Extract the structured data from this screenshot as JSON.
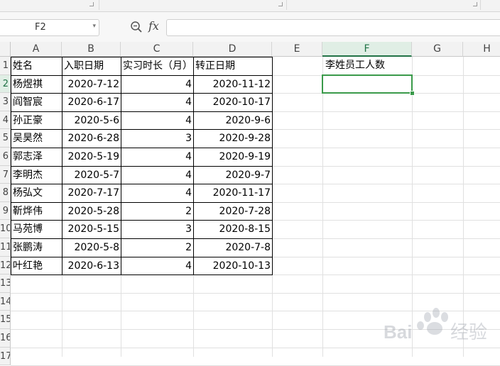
{
  "namebox": {
    "value": "F2"
  },
  "formula": {
    "fx_label": "fx",
    "value": ""
  },
  "columns": [
    "A",
    "B",
    "C",
    "D",
    "E",
    "F",
    "G",
    "H"
  ],
  "active_column": "F",
  "active_row": "2",
  "rows": [
    "1",
    "2",
    "3",
    "4",
    "5",
    "6",
    "7",
    "8",
    "9",
    "10",
    "11",
    "12",
    "13",
    "14",
    "15",
    "16",
    "17"
  ],
  "table": {
    "headers": [
      "姓名",
      "入职日期",
      "实习时长（月）",
      "转正日期"
    ],
    "records": [
      [
        "杨煜祺",
        "2020-7-12",
        "4",
        "2020-11-12"
      ],
      [
        "阎智宸",
        "2020-6-17",
        "4",
        "2020-10-17"
      ],
      [
        "孙正豪",
        "2020-5-6",
        "4",
        "2020-9-6"
      ],
      [
        "吴昊然",
        "2020-6-28",
        "3",
        "2020-9-28"
      ],
      [
        "郭志泽",
        "2020-5-19",
        "4",
        "2020-9-19"
      ],
      [
        "李明杰",
        "2020-5-7",
        "4",
        "2020-9-7"
      ],
      [
        "杨弘文",
        "2020-7-17",
        "4",
        "2020-11-17"
      ],
      [
        "靳烨伟",
        "2020-5-28",
        "2",
        "2020-7-28"
      ],
      [
        "马苑博",
        "2020-5-15",
        "3",
        "2020-8-15"
      ],
      [
        "张鹏涛",
        "2020-5-8",
        "2",
        "2020-7-8"
      ],
      [
        "叶红艳",
        "2020-6-13",
        "4",
        "2020-10-13"
      ]
    ]
  },
  "f1_label": "李姓员工人数",
  "f2_value": "",
  "watermark_text": "Bai 经验",
  "colors": {
    "accent": "#217346",
    "selection": "#3a9a4a"
  }
}
